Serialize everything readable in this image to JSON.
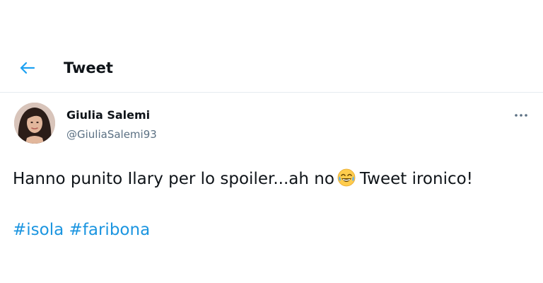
{
  "header": {
    "back_icon": "arrow-left-icon",
    "title": "Tweet",
    "accent_color": "#1da1f2"
  },
  "tweet": {
    "author_name": "Giulia Salemi",
    "author_handle": "@GiuliaSalemi93",
    "avatar_icon": "profile-photo",
    "more_icon": "more-horizontal-icon",
    "text_part1": "Hanno punito Ilary per lo spoiler...ah no",
    "emoji": "face-with-tears-of-joy-emoji",
    "text_part2": "Tweet ironico!",
    "hashtags": [
      "#isola",
      "#faribona"
    ],
    "hashtag_color": "#1b95e0"
  }
}
